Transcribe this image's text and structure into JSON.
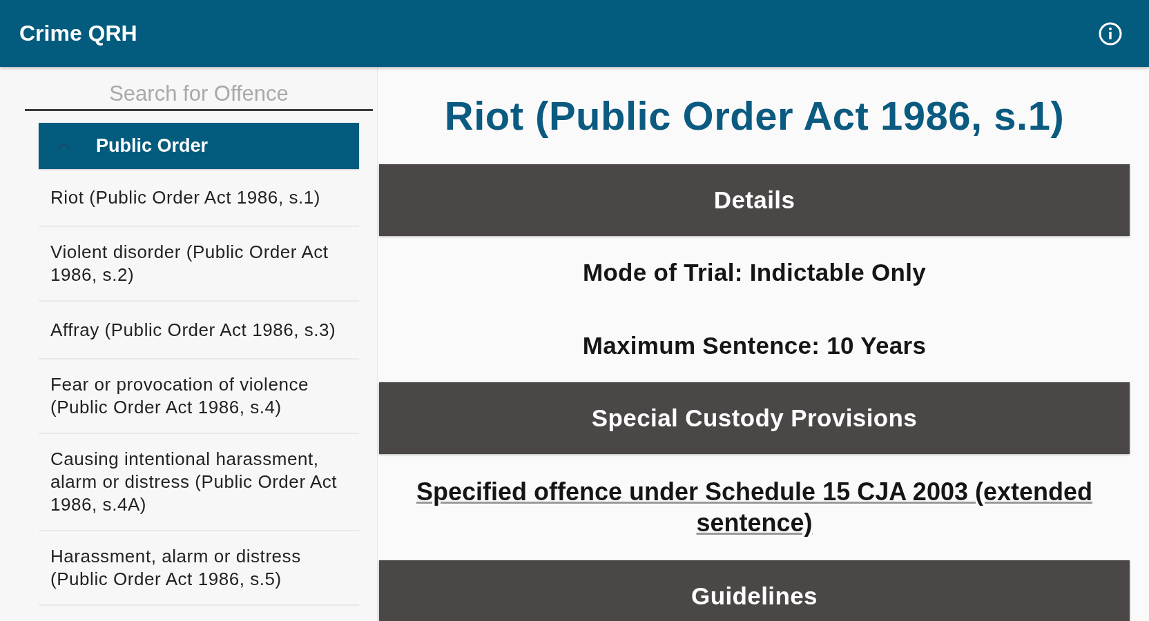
{
  "app_bar": {
    "title": "Crime QRH"
  },
  "sidebar": {
    "search": {
      "placeholder": "Search for Offence"
    },
    "groups": [
      {
        "label": "Public Order",
        "expanded": true,
        "children": [
          {
            "label": "Riot (Public Order Act 1986, s.1)"
          },
          {
            "label": "Violent disorder (Public Order Act 1986, s.2)"
          },
          {
            "label": "Affray (Public Order Act 1986, s.3)"
          },
          {
            "label": "Fear or provocation of violence (Public Order Act 1986, s.4)"
          },
          {
            "label": "Causing intentional harassment, alarm or distress (Public Order Act 1986, s.4A)"
          },
          {
            "label": "Harassment, alarm or distress (Public Order Act 1986, s.5)"
          }
        ]
      }
    ]
  },
  "offence": {
    "title": "Riot (Public Order Act 1986, s.1)",
    "sections": [
      {
        "heading": "Details",
        "lines": [
          {
            "kind": "text",
            "text": "Mode of Trial: Indictable Only"
          },
          {
            "kind": "text",
            "text": "Maximum Sentence: 10 Years"
          }
        ]
      },
      {
        "heading": "Special Custody Provisions",
        "lines": [
          {
            "kind": "link",
            "text": "Specified offence under Schedule 15 CJA 2003 (extended sentence)"
          }
        ]
      },
      {
        "heading": "Guidelines"
      }
    ]
  }
}
